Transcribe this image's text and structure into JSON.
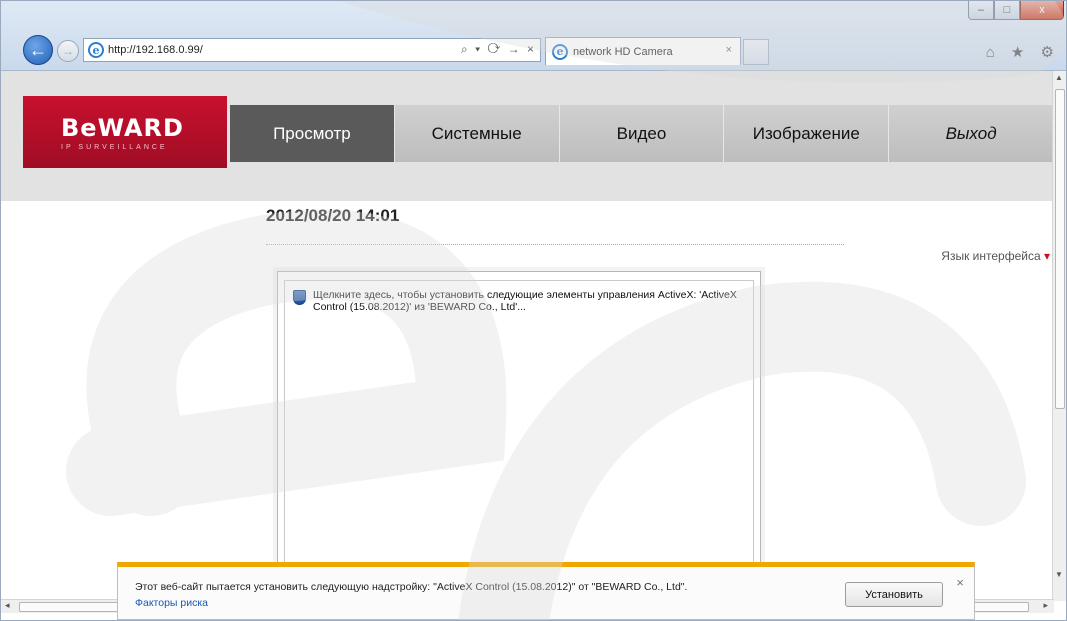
{
  "browser": {
    "url": "http://192.168.0.99/",
    "tab_title": "network HD Camera",
    "tab_close": "×",
    "address_tools": "⌕ ▾ ⟳ → ×",
    "right_icons": "⌂ ★ ⚙",
    "window_controls": {
      "minimize": "–",
      "maximize": "□",
      "close": "x"
    },
    "back": "←",
    "forward": "→"
  },
  "brand": {
    "logo": "BeWARD",
    "tagline": "IP SURVEILLANCE",
    "color": "#c8102e"
  },
  "nav": {
    "items": [
      {
        "label": "Просмотр",
        "active": true
      },
      {
        "label": "Системные"
      },
      {
        "label": "Видео"
      },
      {
        "label": "Изображение"
      },
      {
        "label": "Выход"
      }
    ]
  },
  "main": {
    "datetime": "2012/08/20 14:01",
    "language_link": "Язык интерфейса",
    "activex_message": "Щелкните здесь, чтобы установить следующие элементы управления ActiveX: 'ActiveX Control (15.08.2012)' из 'BEWARD Co., Ltd'..."
  },
  "notification": {
    "text": "Этот веб-сайт пытается установить следующую надстройку: \"ActiveX Control (15.08.2012)\" от \"BEWARD Co., Ltd\".",
    "risk_link": "Факторы риска",
    "install_button": "Установить",
    "close": "×",
    "accent": "#f0a800"
  }
}
